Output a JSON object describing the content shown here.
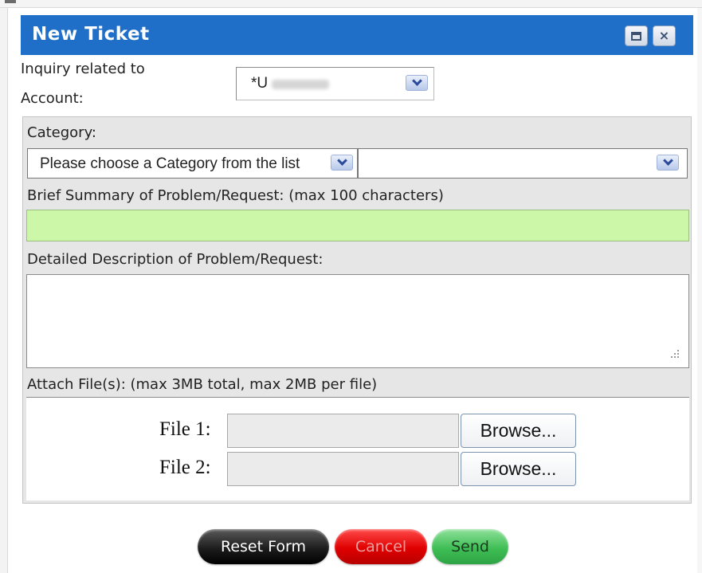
{
  "window": {
    "title": "New Ticket",
    "minimize_icon": "minimize-icon",
    "close_label": "×"
  },
  "account": {
    "label_line1": "Inquiry related to",
    "label_line2": "Account:",
    "selected_value": "*U"
  },
  "category": {
    "label": "Category:",
    "selected": "Please choose a Category from the list",
    "sub_selected": ""
  },
  "summary": {
    "label": "Brief Summary of Problem/Request: (max 100 characters)",
    "value": ""
  },
  "description": {
    "label": "Detailed Description of Problem/Request:",
    "value": ""
  },
  "attachments": {
    "label": "Attach File(s): (max 3MB total, max 2MB per file)",
    "files": [
      {
        "label": "File 1:",
        "browse_label": "Browse..."
      },
      {
        "label": "File 2:",
        "browse_label": "Browse..."
      }
    ]
  },
  "actions": {
    "reset_label": "Reset Form",
    "cancel_label": "Cancel",
    "send_label": "Send"
  },
  "colors": {
    "titlebar": "#1f6fc8",
    "summary_field": "#ccf7a9",
    "reset": "#1d1d1d",
    "cancel": "#e00000",
    "send": "#3fbe55"
  }
}
